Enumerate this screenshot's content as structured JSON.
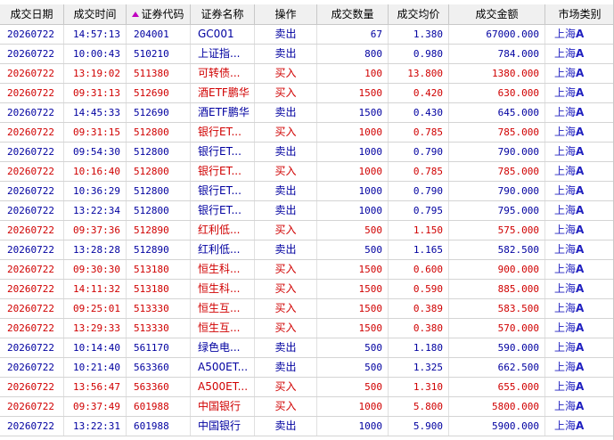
{
  "columns": [
    {
      "key": "date",
      "label": "成交日期"
    },
    {
      "key": "time",
      "label": "成交时间"
    },
    {
      "key": "code",
      "label": "证券代码"
    },
    {
      "key": "name",
      "label": "证券名称"
    },
    {
      "key": "op",
      "label": "操作"
    },
    {
      "key": "qty",
      "label": "成交数量"
    },
    {
      "key": "price",
      "label": "成交均价"
    },
    {
      "key": "amount",
      "label": "成交金额"
    },
    {
      "key": "market",
      "label": "市场类别"
    }
  ],
  "colors": {
    "buy": "#d00000",
    "sell": "#0000a0",
    "market": "#2020c0"
  },
  "rows": [
    {
      "date": "20260722",
      "time": "14:57:13",
      "code": "204001",
      "name": "GC001",
      "op": "卖出",
      "qty": "67",
      "price": "1.380",
      "amount": "67000.000",
      "market_pre": "上海",
      "market_suf": "A",
      "side": "sell"
    },
    {
      "date": "20260722",
      "time": "10:00:43",
      "code": "510210",
      "name": "上证指...",
      "op": "卖出",
      "qty": "800",
      "price": "0.980",
      "amount": "784.000",
      "market_pre": "上海",
      "market_suf": "A",
      "side": "sell"
    },
    {
      "date": "20260722",
      "time": "13:19:02",
      "code": "511380",
      "name": "可转债...",
      "op": "买入",
      "qty": "100",
      "price": "13.800",
      "amount": "1380.000",
      "market_pre": "上海",
      "market_suf": "A",
      "side": "buy"
    },
    {
      "date": "20260722",
      "time": "09:31:13",
      "code": "512690",
      "name": "酒ETF鹏华",
      "op": "买入",
      "qty": "1500",
      "price": "0.420",
      "amount": "630.000",
      "market_pre": "上海",
      "market_suf": "A",
      "side": "buy"
    },
    {
      "date": "20260722",
      "time": "14:45:33",
      "code": "512690",
      "name": "酒ETF鹏华",
      "op": "卖出",
      "qty": "1500",
      "price": "0.430",
      "amount": "645.000",
      "market_pre": "上海",
      "market_suf": "A",
      "side": "sell"
    },
    {
      "date": "20260722",
      "time": "09:31:15",
      "code": "512800",
      "name": "银行ET...",
      "op": "买入",
      "qty": "1000",
      "price": "0.785",
      "amount": "785.000",
      "market_pre": "上海",
      "market_suf": "A",
      "side": "buy"
    },
    {
      "date": "20260722",
      "time": "09:54:30",
      "code": "512800",
      "name": "银行ET...",
      "op": "卖出",
      "qty": "1000",
      "price": "0.790",
      "amount": "790.000",
      "market_pre": "上海",
      "market_suf": "A",
      "side": "sell"
    },
    {
      "date": "20260722",
      "time": "10:16:40",
      "code": "512800",
      "name": "银行ET...",
      "op": "买入",
      "qty": "1000",
      "price": "0.785",
      "amount": "785.000",
      "market_pre": "上海",
      "market_suf": "A",
      "side": "buy"
    },
    {
      "date": "20260722",
      "time": "10:36:29",
      "code": "512800",
      "name": "银行ET...",
      "op": "卖出",
      "qty": "1000",
      "price": "0.790",
      "amount": "790.000",
      "market_pre": "上海",
      "market_suf": "A",
      "side": "sell"
    },
    {
      "date": "20260722",
      "time": "13:22:34",
      "code": "512800",
      "name": "银行ET...",
      "op": "卖出",
      "qty": "1000",
      "price": "0.795",
      "amount": "795.000",
      "market_pre": "上海",
      "market_suf": "A",
      "side": "sell"
    },
    {
      "date": "20260722",
      "time": "09:37:36",
      "code": "512890",
      "name": "红利低...",
      "op": "买入",
      "qty": "500",
      "price": "1.150",
      "amount": "575.000",
      "market_pre": "上海",
      "market_suf": "A",
      "side": "buy"
    },
    {
      "date": "20260722",
      "time": "13:28:28",
      "code": "512890",
      "name": "红利低...",
      "op": "卖出",
      "qty": "500",
      "price": "1.165",
      "amount": "582.500",
      "market_pre": "上海",
      "market_suf": "A",
      "side": "sell"
    },
    {
      "date": "20260722",
      "time": "09:30:30",
      "code": "513180",
      "name": "恒生科...",
      "op": "买入",
      "qty": "1500",
      "price": "0.600",
      "amount": "900.000",
      "market_pre": "上海",
      "market_suf": "A",
      "side": "buy"
    },
    {
      "date": "20260722",
      "time": "14:11:32",
      "code": "513180",
      "name": "恒生科...",
      "op": "买入",
      "qty": "1500",
      "price": "0.590",
      "amount": "885.000",
      "market_pre": "上海",
      "market_suf": "A",
      "side": "buy"
    },
    {
      "date": "20260722",
      "time": "09:25:01",
      "code": "513330",
      "name": "恒生互...",
      "op": "买入",
      "qty": "1500",
      "price": "0.389",
      "amount": "583.500",
      "market_pre": "上海",
      "market_suf": "A",
      "side": "buy"
    },
    {
      "date": "20260722",
      "time": "13:29:33",
      "code": "513330",
      "name": "恒生互...",
      "op": "买入",
      "qty": "1500",
      "price": "0.380",
      "amount": "570.000",
      "market_pre": "上海",
      "market_suf": "A",
      "side": "buy"
    },
    {
      "date": "20260722",
      "time": "10:14:40",
      "code": "561170",
      "name": "绿色电...",
      "op": "卖出",
      "qty": "500",
      "price": "1.180",
      "amount": "590.000",
      "market_pre": "上海",
      "market_suf": "A",
      "side": "sell"
    },
    {
      "date": "20260722",
      "time": "10:21:40",
      "code": "563360",
      "name": "A500ET...",
      "op": "卖出",
      "qty": "500",
      "price": "1.325",
      "amount": "662.500",
      "market_pre": "上海",
      "market_suf": "A",
      "side": "sell"
    },
    {
      "date": "20260722",
      "time": "13:56:47",
      "code": "563360",
      "name": "A500ET...",
      "op": "买入",
      "qty": "500",
      "price": "1.310",
      "amount": "655.000",
      "market_pre": "上海",
      "market_suf": "A",
      "side": "buy"
    },
    {
      "date": "20260722",
      "time": "09:37:49",
      "code": "601988",
      "name": "中国银行",
      "op": "买入",
      "qty": "1000",
      "price": "5.800",
      "amount": "5800.000",
      "market_pre": "上海",
      "market_suf": "A",
      "side": "buy"
    },
    {
      "date": "20260722",
      "time": "13:22:31",
      "code": "601988",
      "name": "中国银行",
      "op": "卖出",
      "qty": "1000",
      "price": "5.900",
      "amount": "5900.000",
      "market_pre": "上海",
      "market_suf": "A",
      "side": "sell"
    }
  ]
}
